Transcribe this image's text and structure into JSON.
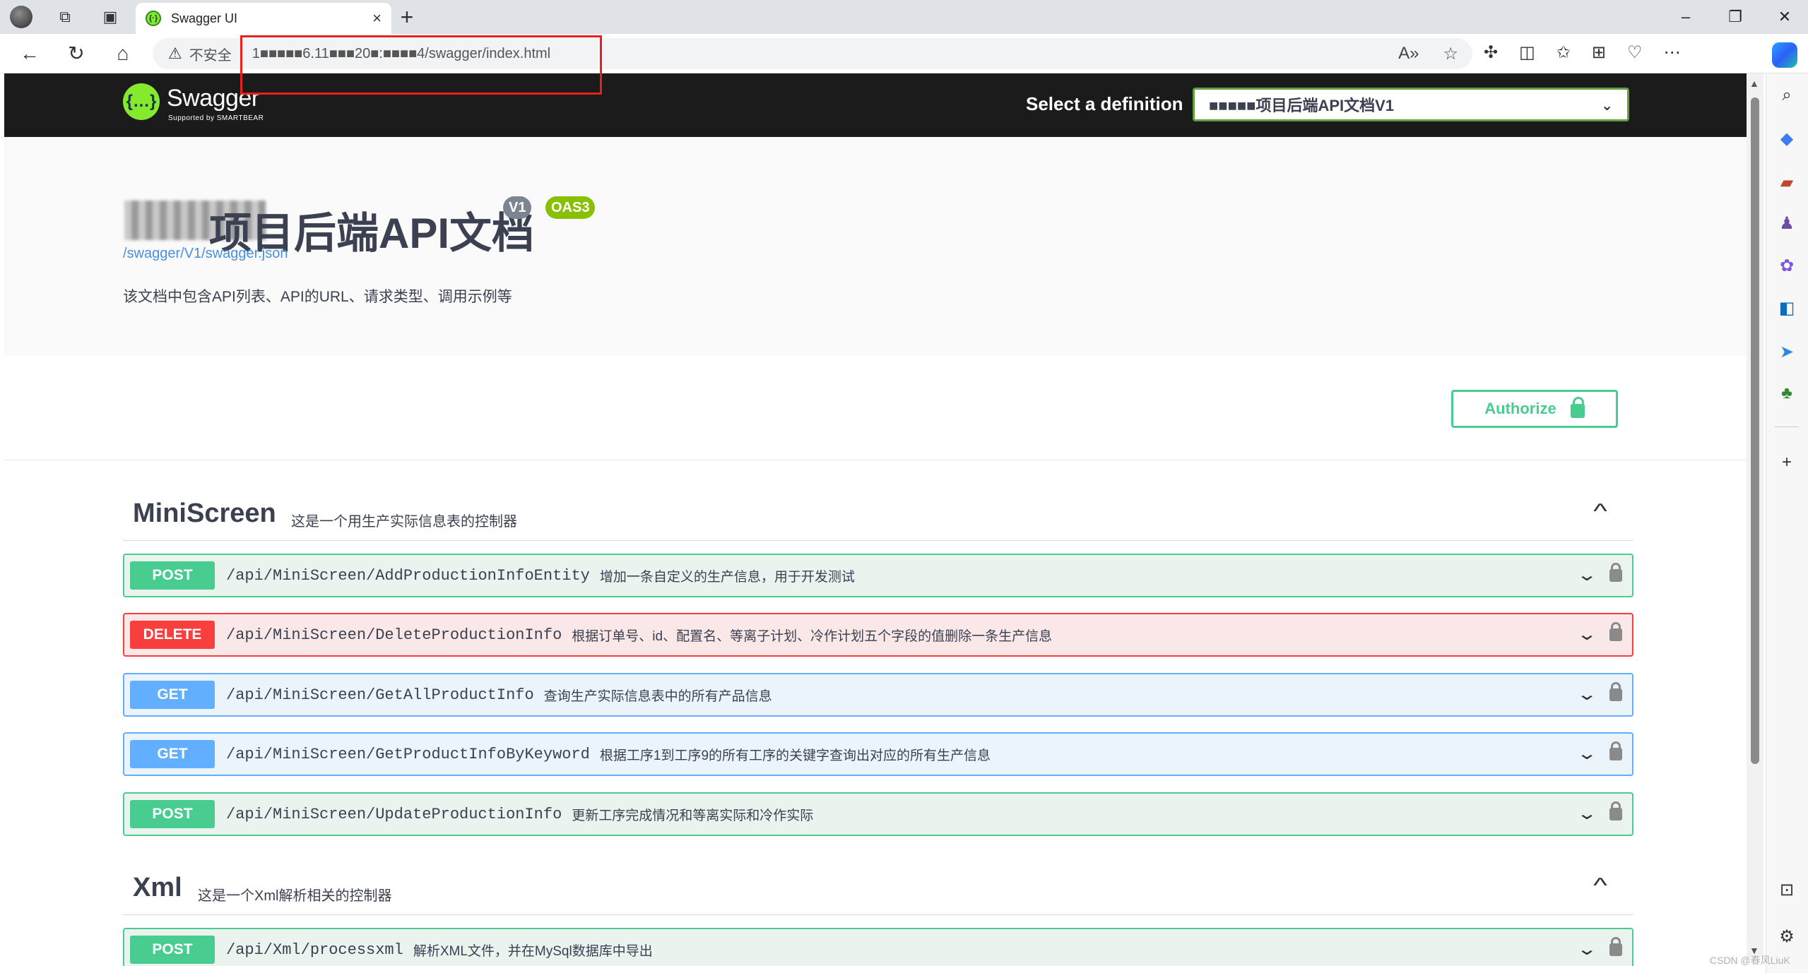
{
  "browser": {
    "tab_title": "Swagger UI",
    "tab_favicon": "{·}",
    "new_tab_icon": "+",
    "close_tab_icon": "×",
    "insecure_label": "不安全",
    "url_text": "1■■■■■6.11■■■20■:■■■■4/swagger/index.html",
    "window_controls": [
      "–",
      "❐",
      "✕"
    ]
  },
  "swagger": {
    "logo_glyph": "{…}",
    "logo_text": "Swagger",
    "logo_sub": "Supported by SMARTBEAR",
    "select_label": "Select a definition",
    "select_value": "■■■■■项目后端API文档V1",
    "title": "项目后端API文档",
    "badge_version": "V1",
    "badge_oas": "OAS3",
    "json_link": "/swagger/V1/swagger.json",
    "description": "该文档中包含API列表、API的URL、请求类型、调用示例等",
    "authorize_label": "Authorize",
    "sections": [
      {
        "name": "MiniScreen",
        "description": "这是一个用生产实际信息表的控制器",
        "operations": [
          {
            "method": "POST",
            "path": "/api/MiniScreen/AddProductionInfoEntity",
            "summary": "增加一条自定义的生产信息，用于开发测试"
          },
          {
            "method": "DELETE",
            "path": "/api/MiniScreen/DeleteProductionInfo",
            "summary": "根据订单号、id、配置名、等离子计划、冷作计划五个字段的值删除一条生产信息"
          },
          {
            "method": "GET",
            "path": "/api/MiniScreen/GetAllProductInfo",
            "summary": "查询生产实际信息表中的所有产品信息"
          },
          {
            "method": "GET",
            "path": "/api/MiniScreen/GetProductInfoByKeyword",
            "summary": "根据工序1到工序9的所有工序的关键字查询出对应的所有生产信息"
          },
          {
            "method": "POST",
            "path": "/api/MiniScreen/UpdateProductionInfo",
            "summary": "更新工序完成情况和等离实际和冷作实际"
          }
        ]
      },
      {
        "name": "Xml",
        "description": "这是一个Xml解析相关的控制器",
        "operations": [
          {
            "method": "POST",
            "path": "/api/Xml/processxml",
            "summary": "解析XML文件，并在MySql数据库中导出"
          }
        ]
      }
    ]
  },
  "watermark": "CSDN @春风LiuK",
  "colors": {
    "post": "#49cc90",
    "delete": "#f93e3e",
    "get": "#61affe",
    "swagger_green": "#85ea2d",
    "highlight_red": "#e8201f"
  }
}
